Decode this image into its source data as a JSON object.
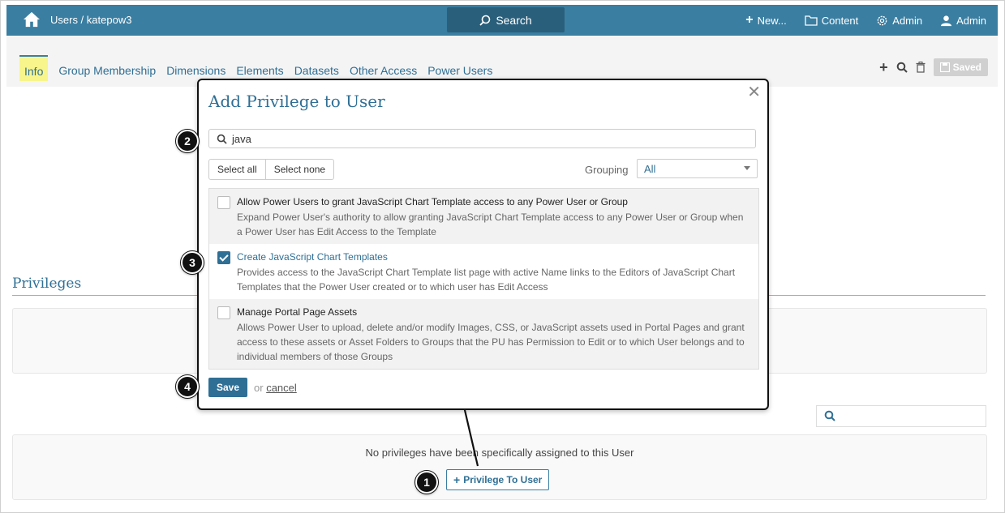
{
  "topbar": {
    "breadcrumb": "Users / katepow3",
    "search_label": "Search",
    "new_label": "New...",
    "content_label": "Content",
    "admin_label": "Admin",
    "user_label": "Admin"
  },
  "tabs": [
    "Info",
    "Group Membership",
    "Dimensions",
    "Elements",
    "Datasets",
    "Other Access",
    "Power Users"
  ],
  "toolbar": {
    "saved_label": "Saved"
  },
  "privileges": {
    "title": "Privileges",
    "empty_text": "No privileges have been specifically assigned to this User",
    "add_button": "Privilege To User"
  },
  "modal": {
    "title": "Add Privilege to User",
    "search_value": "java",
    "select_all": "Select all",
    "select_none": "Select none",
    "grouping_label": "Grouping",
    "grouping_value": "All",
    "items": [
      {
        "title": "Allow Power Users to grant JavaScript Chart Template access to any Power User or Group",
        "desc1": "Expand Power User's authority to allow granting JavaScript Chart Template access to any Power User or Group when",
        "desc2": "a Power User has Edit Access to the Template",
        "desc3": "",
        "checked": false
      },
      {
        "title": "Create JavaScript Chart Templates",
        "desc1": "Provides access to the JavaScript Chart Template list page with active Name links to the Editors of JavaScript Chart",
        "desc2": "Templates that the Power User created or to which user has Edit Access",
        "desc3": "",
        "checked": true
      },
      {
        "title": "Manage Portal Page Assets",
        "desc1": "Allows Power User to upload, delete and/or modify Images, CSS, or JavaScript assets used in Portal Pages and grant",
        "desc2": "access to these assets or Asset Folders to Groups that the PU has Permission to Edit or to which User belongs and to",
        "desc3": "individual members of those Groups",
        "checked": false
      }
    ],
    "save_label": "Save",
    "or_label": "or",
    "cancel_label": "cancel"
  },
  "callouts": [
    "1",
    "2",
    "3",
    "4"
  ],
  "colors": {
    "brand": "#3a7ea1",
    "link": "#2f6f95",
    "active_tab": "#f7f58c"
  }
}
